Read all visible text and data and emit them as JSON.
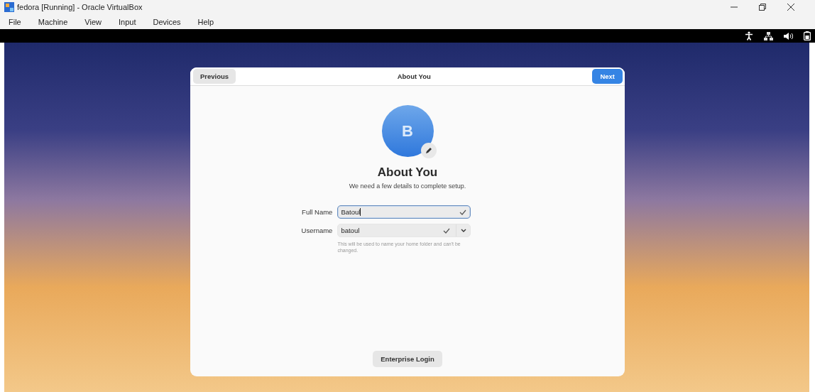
{
  "window": {
    "title": "fedora [Running] - Oracle VirtualBox"
  },
  "menu": [
    "File",
    "Machine",
    "View",
    "Input",
    "Devices",
    "Help"
  ],
  "dialog": {
    "title": "About You",
    "previous": "Previous",
    "next": "Next",
    "avatar_letter": "B",
    "heading": "About You",
    "subtitle": "We need a few details to complete setup.",
    "fields": [
      {
        "label": "Full Name",
        "value": "Batoul",
        "focused": true,
        "valid": true,
        "kind": "text"
      },
      {
        "label": "Username",
        "value": "batoul",
        "focused": false,
        "valid": true,
        "kind": "combo",
        "hint": "This will be used to name your home folder and can't be changed."
      }
    ],
    "enterprise": "Enterprise Login"
  }
}
